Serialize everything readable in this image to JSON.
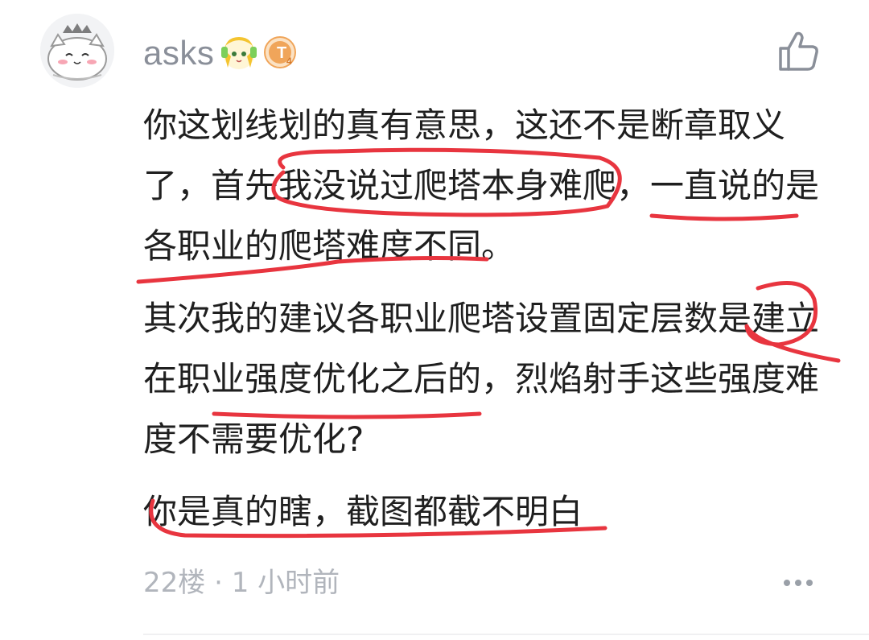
{
  "post": {
    "username": "asks",
    "level_badge_letter": "T",
    "level_badge_sub": "4",
    "paragraphs": [
      "你这划线划的真有意思，这还不是断章取义了，首先我没说过爬塔本身难爬，一直说的是各职业的爬塔难度不同。",
      "其次我的建议各职业爬塔设置固定层数是建立在职业强度优化之后的，烈焰射手这些强度难度不需要优化?",
      "你是真的瞎，截图都截不明白"
    ],
    "floor": "22楼",
    "separator": "·",
    "time": "1 小时前"
  },
  "icons": {
    "like": "thumbs-up-icon",
    "more": "more-dots-icon"
  },
  "colors": {
    "username": "#8a8f99",
    "body_text": "#1f1f1f",
    "meta_text": "#b1b5bc",
    "red_ink": "#e8353f",
    "level_badge": "#f0a55a"
  }
}
